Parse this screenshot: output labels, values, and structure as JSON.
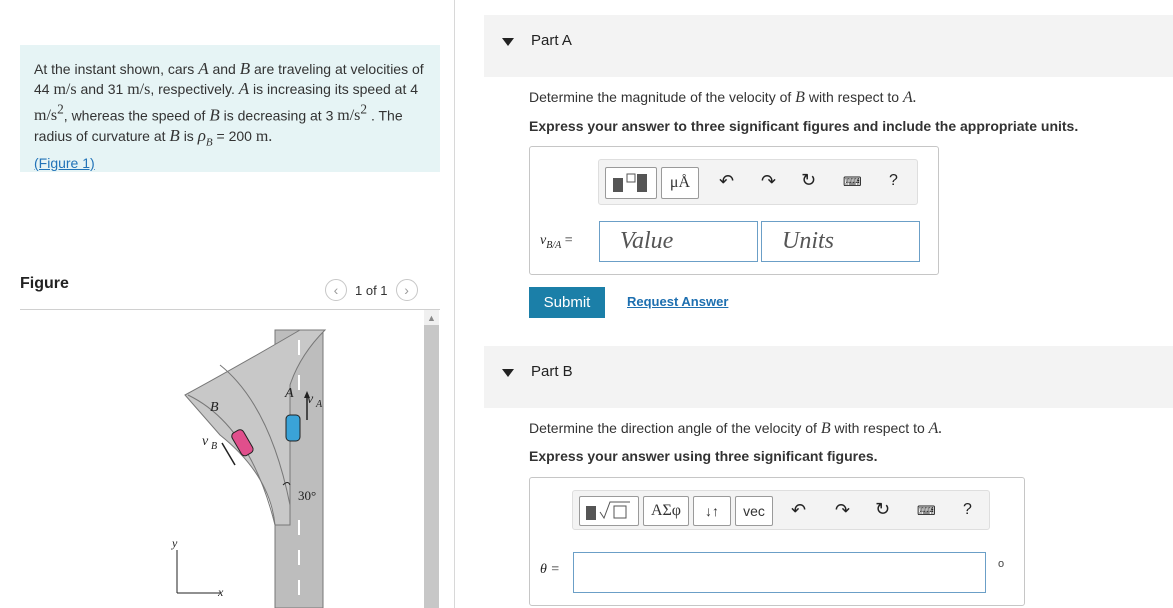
{
  "problem": {
    "intro": "At the instant shown, cars",
    "car_a": "A",
    "and": "and",
    "car_b": "B",
    "traveling": "are traveling at velocities of",
    "v1": "44",
    "unit_ms": "m/s",
    "and2": "and",
    "v2": "31",
    "respectively": ", respectively.",
    "a_incr": "is increasing its speed at",
    "accel_a": "4",
    "unit_ms2": "m/s",
    "whereas": ", whereas the speed of",
    "b_decr": "is decreasing at",
    "accel_b": "3",
    "radius_text": ". The radius of curvature at",
    "is": "is",
    "rho": "ρ",
    "rho_sub": "B",
    "eq": "= 200",
    "unit_m": "m.",
    "figure_link": "(Figure 1)"
  },
  "figure_panel": {
    "title": "Figure",
    "pager": "1 of 1",
    "prev_icon": "chevron-left-icon",
    "next_icon": "chevron-right-icon",
    "labels": {
      "A": "A",
      "vA": "v",
      "vA_sub": "A",
      "B": "B",
      "vB": "v",
      "vB_sub": "B",
      "angle": "30°",
      "y": "y",
      "x": "x"
    }
  },
  "partA": {
    "title": "Part A",
    "question_pre": "Determine the magnitude of the velocity of",
    "sym_b": "B",
    "with_respect": "with respect to",
    "sym_a": "A.",
    "instruction": "Express your answer to three significant figures and include the appropriate units.",
    "toolbar": {
      "units_btn": "μÅ",
      "help": "?"
    },
    "label": "v",
    "label_sub": "B/A",
    "label_eq": "=",
    "value_placeholder": "Value",
    "units_placeholder": "Units",
    "submit": "Submit",
    "request": "Request Answer"
  },
  "partB": {
    "title": "Part B",
    "question_pre": "Determine the direction angle of the velocity of",
    "sym_b": "B",
    "with_respect": "with respect to",
    "sym_a": "A.",
    "instruction": "Express your answer using three significant figures.",
    "toolbar": {
      "greek_btn": "ΑΣφ",
      "vec_btn": "vec",
      "help": "?"
    },
    "label": "θ =",
    "degree": "o"
  }
}
